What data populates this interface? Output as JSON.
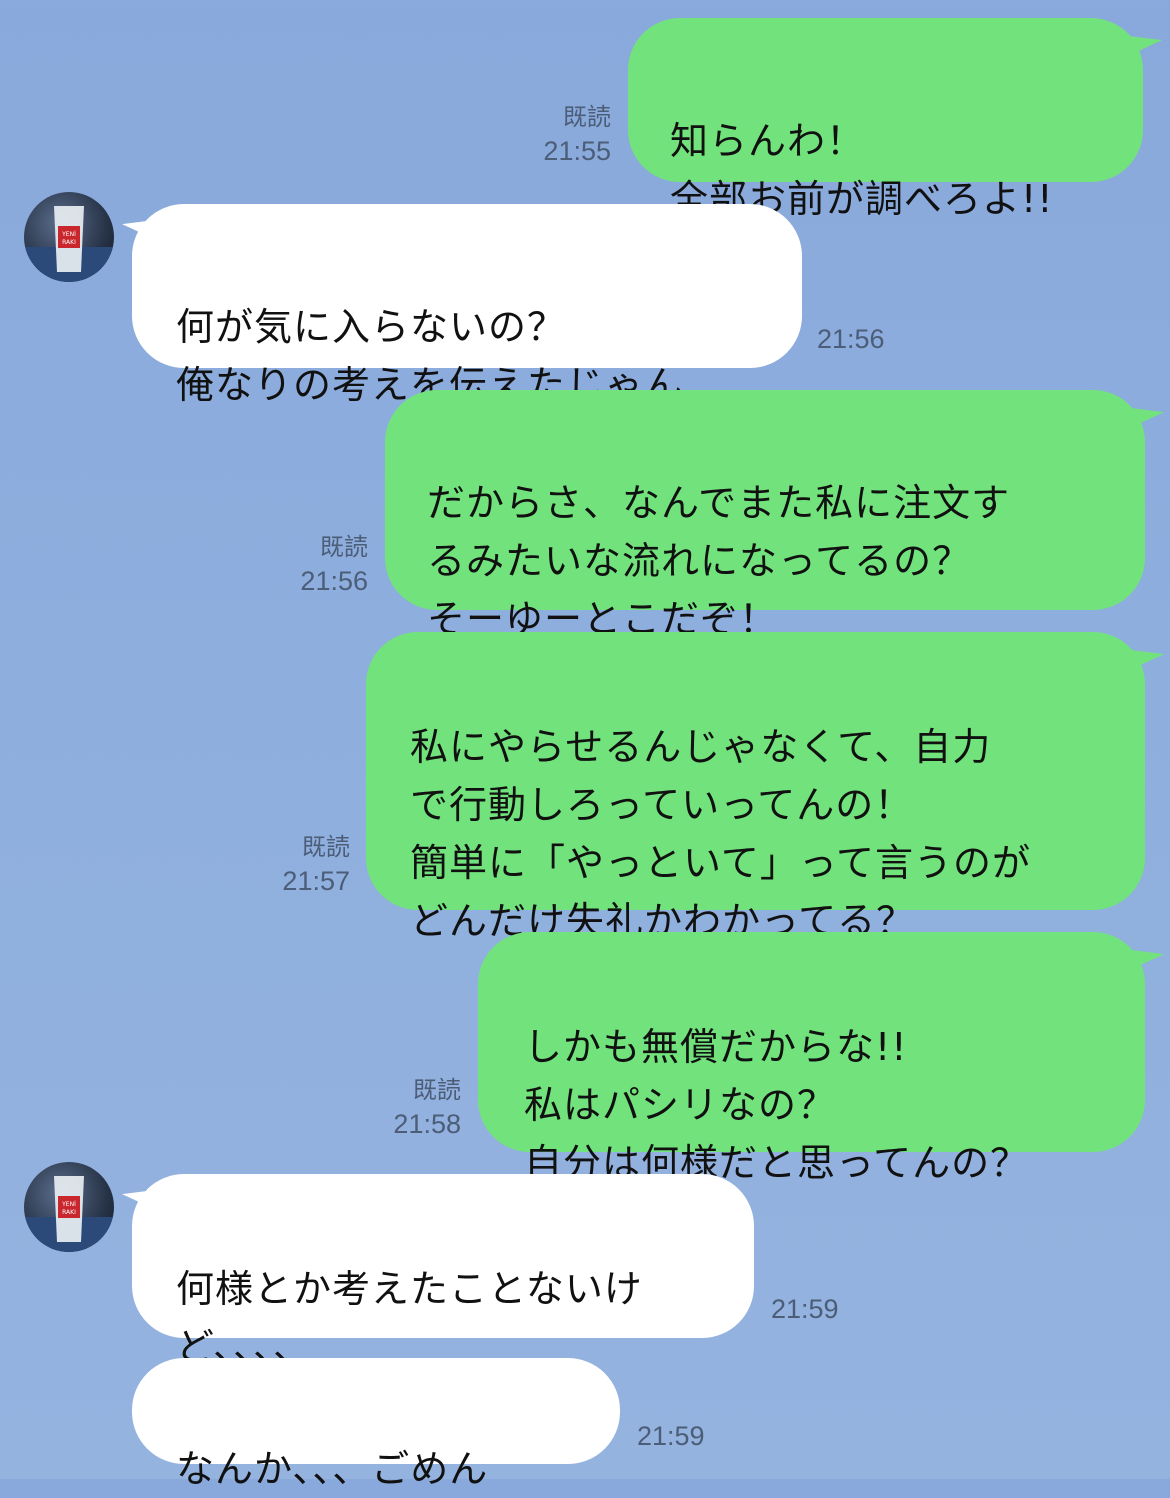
{
  "messages": [
    {
      "side": "out",
      "text": "知らんわ！\n全部お前が調べろよ!!",
      "read": "既読",
      "time": "21:55"
    },
    {
      "side": "in",
      "text": "何が気に入らないの？\n俺なりの考えを伝えたじゃん",
      "time": "21:56"
    },
    {
      "side": "out",
      "text": "だからさ、なんでまた私に注文す\nるみたいな流れになってるの？\nそーゆーとこだぞ！",
      "read": "既読",
      "time": "21:56"
    },
    {
      "side": "out",
      "text": "私にやらせるんじゃなくて、自力\nで行動しろっていってんの！\n簡単に「やっといて」って言うのが\nどんだけ失礼かわかってる？",
      "read": "既読",
      "time": "21:57"
    },
    {
      "side": "out",
      "text": "しかも無償だからな!!\n私はパシリなの？\n自分は何様だと思ってんの？",
      "read": "既読",
      "time": "21:58"
    },
    {
      "side": "in",
      "text": "何様とか考えたことないけ\nど、、、、",
      "time": "21:59"
    },
    {
      "side": "in",
      "text": "なんか、、、ごめん",
      "time": "21:59"
    }
  ],
  "avatar": {
    "icon": "raki-glass-avatar-icon",
    "label": "YENİ RAKI"
  },
  "colors": {
    "background": "#8eaedd",
    "outgoing_bubble": "#72e37c",
    "incoming_bubble": "#ffffff",
    "meta_text": "#4c5d78"
  }
}
